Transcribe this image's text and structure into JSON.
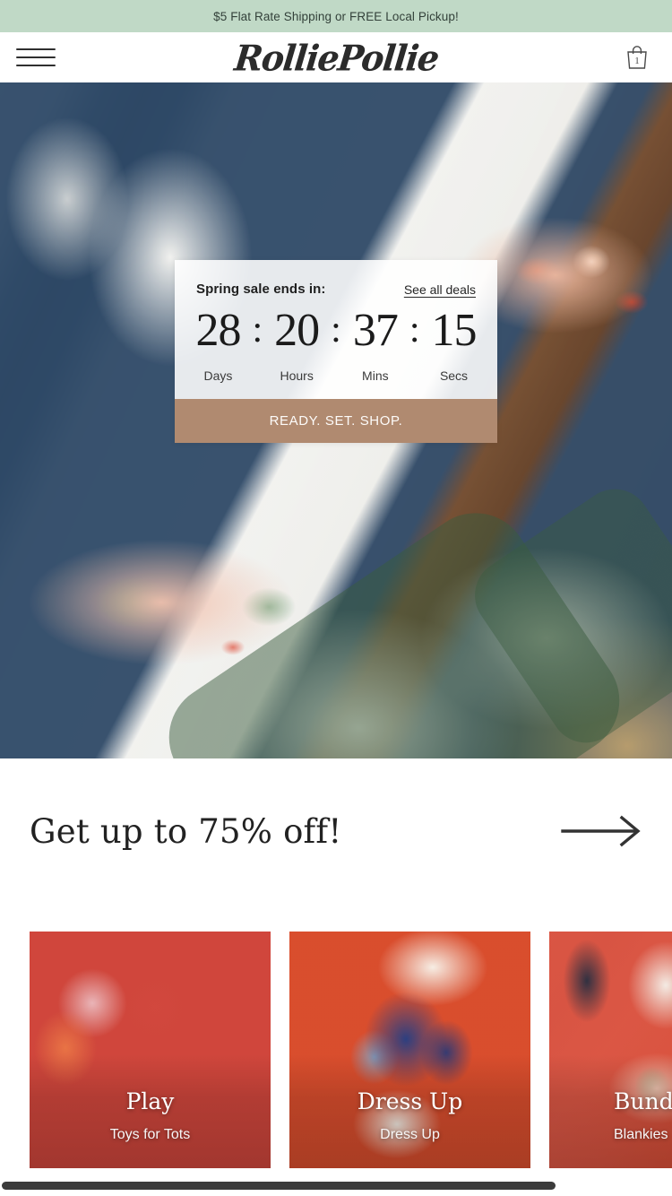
{
  "announcement": {
    "text": "$5 Flat Rate Shipping or FREE Local Pickup!",
    "background": "#c0d9c6"
  },
  "header": {
    "menu_icon": "hamburger-menu-icon",
    "logo_text": "RolliePollie",
    "cart_icon": "shopping-bag-icon",
    "cart_count": "1"
  },
  "hero": {
    "alt": "baby muslin swaddle blankets rolled on wood floor",
    "countdown": {
      "title": "Spring sale ends in:",
      "link_label": "See all deals",
      "separator": ":",
      "units": [
        {
          "value": "28",
          "label": "Days"
        },
        {
          "value": "20",
          "label": "Hours"
        },
        {
          "value": "37",
          "label": "Mins"
        },
        {
          "value": "15",
          "label": "Secs"
        }
      ],
      "button_label": "READY. SET. SHOP.",
      "button_color": "#b08a70"
    }
  },
  "promo": {
    "title": "Get up to 75% off!",
    "arrow_icon": "arrow-right-icon"
  },
  "categories": [
    {
      "title": "Play",
      "subtitle": "Toys for Tots"
    },
    {
      "title": "Dress Up",
      "subtitle": "Dress Up"
    },
    {
      "title": "Bundle Up",
      "subtitle": "Blankies"
    }
  ]
}
